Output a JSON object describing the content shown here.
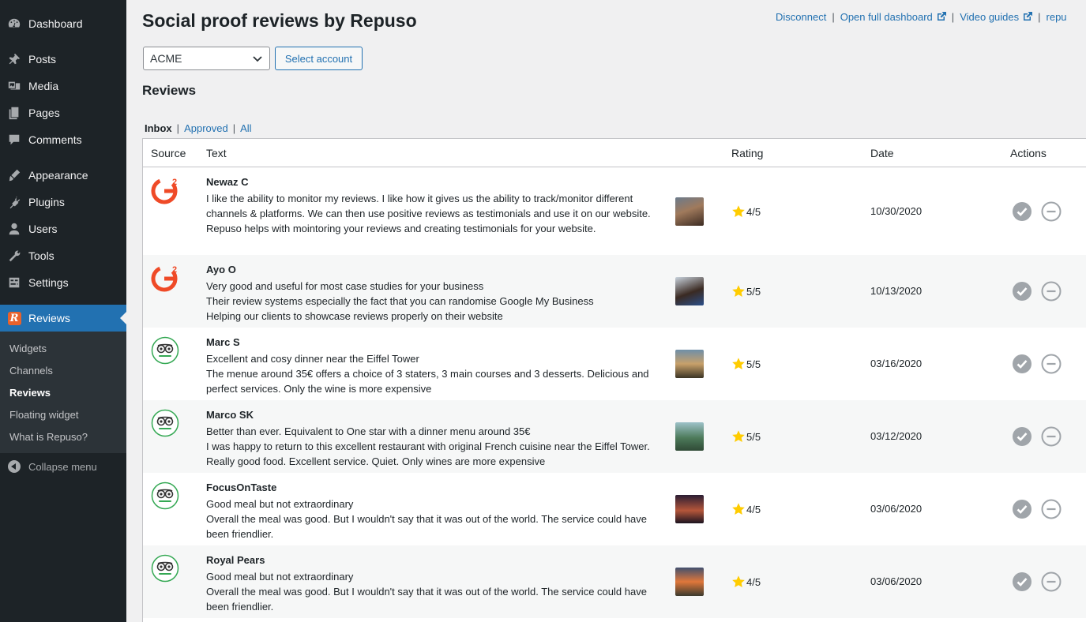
{
  "sidebar": {
    "items": [
      {
        "label": "Dashboard",
        "icon": "dashboard-icon"
      },
      {
        "label": "Posts",
        "icon": "pin-icon"
      },
      {
        "label": "Media",
        "icon": "media-icon"
      },
      {
        "label": "Pages",
        "icon": "pages-icon"
      },
      {
        "label": "Comments",
        "icon": "comment-icon"
      },
      {
        "label": "Appearance",
        "icon": "brush-icon"
      },
      {
        "label": "Plugins",
        "icon": "plug-icon"
      },
      {
        "label": "Users",
        "icon": "user-icon"
      },
      {
        "label": "Tools",
        "icon": "wrench-icon"
      },
      {
        "label": "Settings",
        "icon": "settings-icon"
      },
      {
        "label": "Reviews",
        "icon": "repuso-logo-icon",
        "logo_letter": "R"
      }
    ],
    "submenu": [
      {
        "label": "Widgets"
      },
      {
        "label": "Channels"
      },
      {
        "label": "Reviews"
      },
      {
        "label": "Floating widget"
      },
      {
        "label": "What is Repuso?"
      }
    ],
    "collapse_label": "Collapse menu"
  },
  "page": {
    "title": "Social proof reviews by Repuso",
    "links": {
      "disconnect": "Disconnect",
      "open_dashboard": "Open full dashboard",
      "video_guides": "Video guides",
      "repuso": "repu"
    },
    "account_select_value": "ACME",
    "select_account_button": "Select account",
    "reviews_heading": "Reviews",
    "filter_tabs": [
      "Inbox",
      "Approved",
      "All"
    ],
    "table_headers": {
      "source": "Source",
      "text": "Text",
      "rating": "Rating",
      "date": "Date",
      "actions": "Actions"
    }
  },
  "reviews": [
    {
      "source": "G2",
      "source_icon": "g2-logo-icon",
      "author": "Newaz C",
      "lines": [
        "I like the ability to monitor my reviews. I like how it gives us the ability to track/monitor different channels & platforms. We can then use positive reviews as testimonials and use it on our website.",
        "Repuso helps with mointoring your reviews and creating testimonials for your website."
      ],
      "rating": "4/5",
      "date": "10/30/2020"
    },
    {
      "source": "G2",
      "source_icon": "g2-logo-icon",
      "author": "Ayo O",
      "lines": [
        "Very good and useful for most case studies for your business",
        "Their review systems especially the fact that you can randomise Google My Business",
        "Helping our clients to showcase reviews properly on their website"
      ],
      "rating": "5/5",
      "date": "10/13/2020"
    },
    {
      "source": "TripAdvisor",
      "source_icon": "tripadvisor-logo-icon",
      "author": "Marc S",
      "lines": [
        "Excellent and cosy dinner near the Eiffel Tower",
        "The menue around 35€ offers a choice of 3 staters, 3 main courses and 3 desserts. Delicious and perfect services. Only the wine is more expensive"
      ],
      "rating": "5/5",
      "date": "03/16/2020"
    },
    {
      "source": "TripAdvisor",
      "source_icon": "tripadvisor-logo-icon",
      "author": "Marco SK",
      "lines": [
        "Better than ever. Equivalent to One star with a dinner menu around 35€",
        "I was happy to return to this excellent restaurant with original French cuisine near the Eiffel Tower. Really good food. Excellent service. Quiet. Only wines are more expensive"
      ],
      "rating": "5/5",
      "date": "03/12/2020"
    },
    {
      "source": "TripAdvisor",
      "source_icon": "tripadvisor-logo-icon",
      "author": "FocusOnTaste",
      "lines": [
        "Good meal but not extraordinary",
        "Overall the meal was good. But I wouldn't say that it was out of the world. The service could have been friendlier."
      ],
      "rating": "4/5",
      "date": "03/06/2020"
    },
    {
      "source": "TripAdvisor",
      "source_icon": "tripadvisor-logo-icon",
      "author": "Royal Pears",
      "lines": [
        "Good meal but not extraordinary",
        "Overall the meal was good. But I wouldn't say that it was out of the world. The service could have been friendlier."
      ],
      "rating": "4/5",
      "date": "03/06/2020"
    }
  ],
  "colors": {
    "sidebar_bg": "#1d2327",
    "submenu_bg": "#2c3338",
    "accent": "#2271b1",
    "g2_red": "#ef4a27",
    "tripadvisor_green": "#34a853",
    "star_yellow": "#ffcc00",
    "action_gray": "#a0a5aa"
  }
}
